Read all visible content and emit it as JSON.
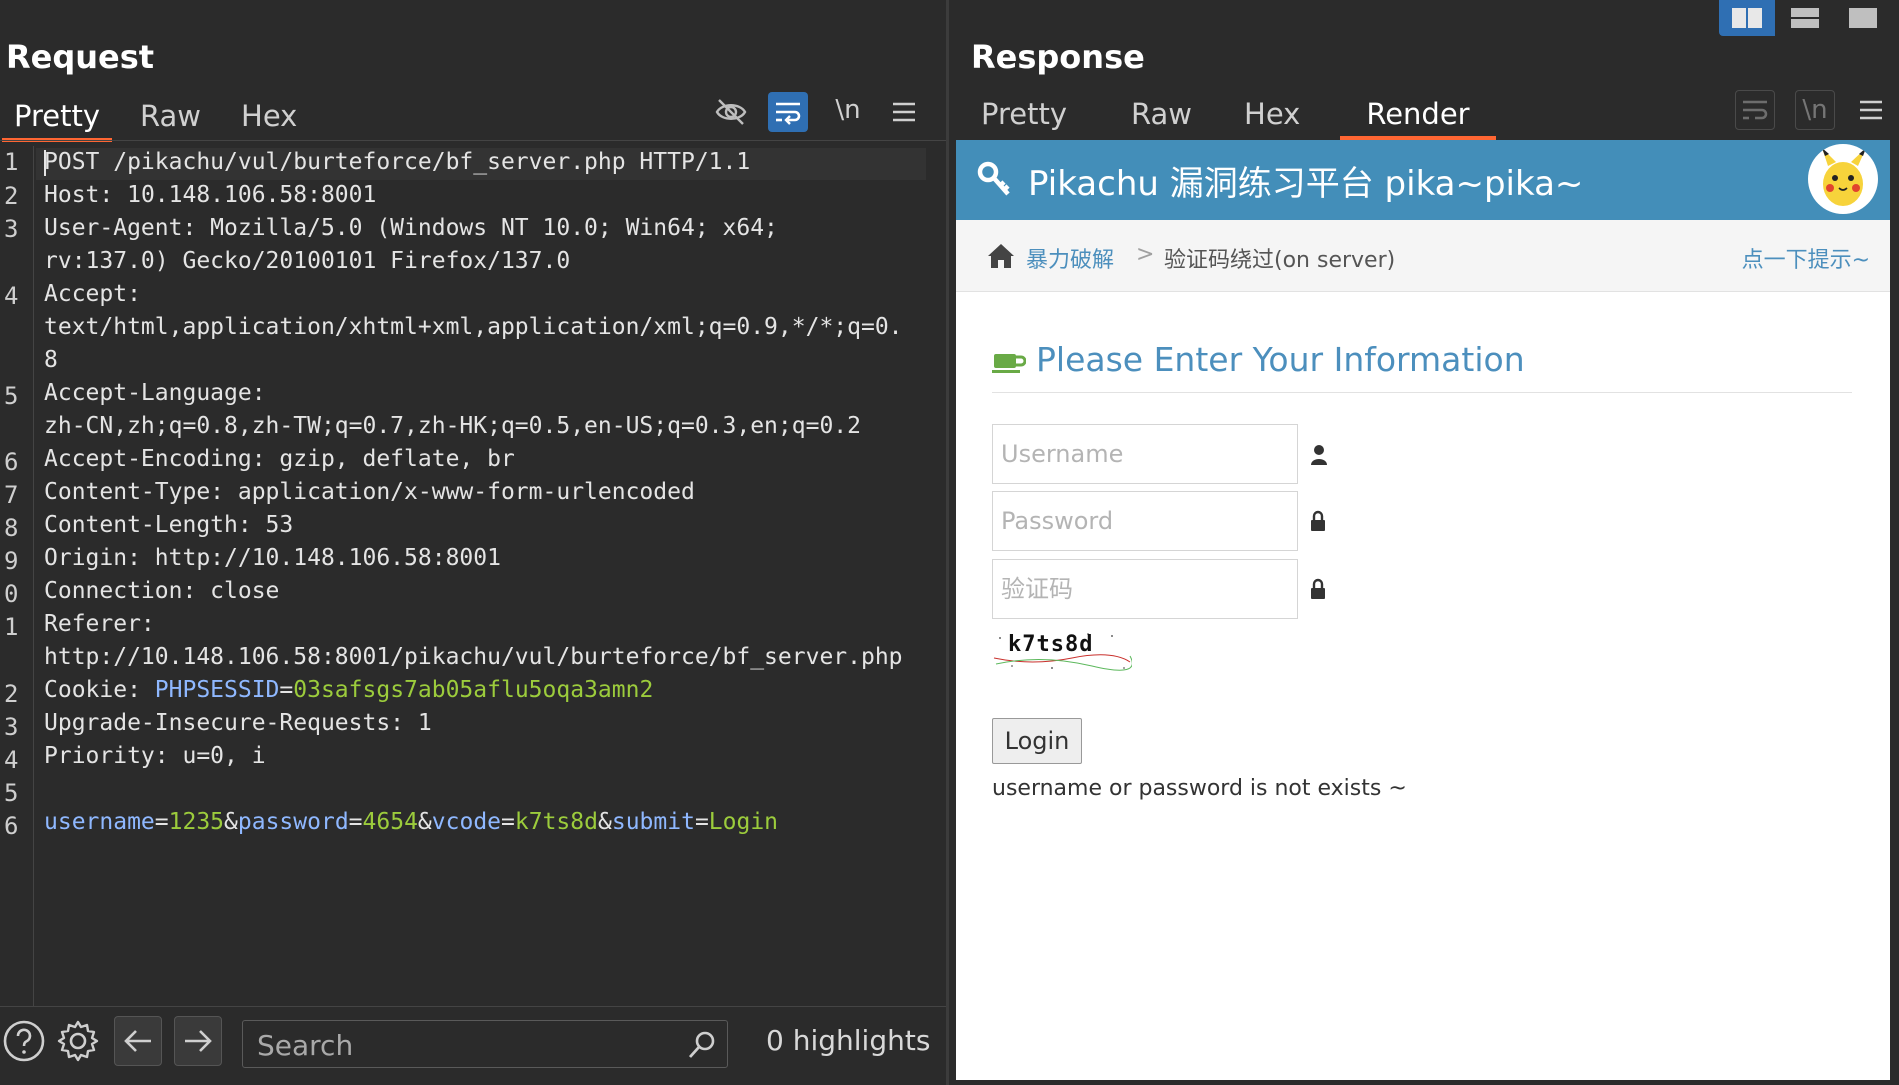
{
  "request": {
    "title": "Request",
    "tabs": [
      {
        "label": "Pretty",
        "active": true
      },
      {
        "label": "Raw",
        "active": false
      },
      {
        "label": "Hex",
        "active": false
      }
    ],
    "toolbar": {
      "newline_label": "\\n",
      "icons": [
        "eye-off-icon",
        "wrap-icon",
        "newline-icon",
        "menu-icon"
      ]
    },
    "line_numbers": [
      "1",
      "2",
      "3",
      "",
      "4",
      "",
      "",
      "5",
      "",
      "6",
      "7",
      "8",
      "9",
      "0",
      "1",
      "",
      "2",
      "3",
      "4",
      "5",
      "6"
    ],
    "lines": {
      "l1": "POST /pikachu/vul/burteforce/bf_server.php HTTP/1.1",
      "l2_key": "Host: ",
      "l2_val": "10.148.106.58:8001",
      "l3a": "User-Agent: Mozilla/5.0 (Windows NT 10.0; Win64; x64;",
      "l3b": "rv:137.0) Gecko/20100101 Firefox/137.0",
      "l4a": "Accept:",
      "l4b": "text/html,application/xhtml+xml,application/xml;q=0.9,*/*;q=0.",
      "l4c": "8",
      "l5a": "Accept-Language:",
      "l5b": "zh-CN,zh;q=0.8,zh-TW;q=0.7,zh-HK;q=0.5,en-US;q=0.3,en;q=0.2",
      "l6": "Accept-Encoding: gzip, deflate, br",
      "l7": "Content-Type: application/x-www-form-urlencoded",
      "l8": "Content-Length: 53",
      "l9": "Origin: http://10.148.106.58:8001",
      "l10": "Connection: close",
      "l11a": "Referer:",
      "l11b": "http://10.148.106.58:8001/pikachu/vul/burteforce/bf_server.php",
      "l12_key": "Cookie: ",
      "l12_name": "PHPSESSID",
      "l12_eq": "=",
      "l12_val": "03safsgs7ab05aflu5oqa3amn2",
      "l13": "Upgrade-Insecure-Requests: 1",
      "l14": "Priority: u=0, i",
      "body": {
        "k1": "username",
        "e1": "=",
        "v1": "1235",
        "a1": "&",
        "k2": "password",
        "e2": "=",
        "v2": "4654",
        "a2": "&",
        "k3": "vcode",
        "e3": "=",
        "v3": "k7ts8d",
        "a3": "&",
        "k4": "submit",
        "e4": "=",
        "v4": "Login"
      }
    },
    "search": {
      "placeholder": "Search",
      "value": ""
    },
    "highlights": "0 highlights"
  },
  "response": {
    "title": "Response",
    "tabs": [
      {
        "label": "Pretty",
        "active": false
      },
      {
        "label": "Raw",
        "active": false
      },
      {
        "label": "Hex",
        "active": false
      },
      {
        "label": "Render",
        "active": true
      }
    ],
    "newline_label": "\\n",
    "layout_buttons": [
      "split-horizontal-icon",
      "split-vertical-icon",
      "single-pane-icon"
    ],
    "render": {
      "site_title": "Pikachu 漏洞练习平台 pika~pika~",
      "breadcrumb": {
        "link": "暴力破解",
        "sep": ">",
        "current": "验证码绕过(on server)",
        "hint": "点一下提示~"
      },
      "heading": "Please Enter Your Information",
      "username_placeholder": "Username",
      "password_placeholder": "Password",
      "vcode_placeholder": "验证码",
      "captcha_text": "k7ts8d",
      "login_label": "Login",
      "message": "username or password is not exists ~"
    }
  },
  "colors": {
    "accent_orange": "#ff6633",
    "active_blue": "#2f6fb3",
    "pikachu_blue": "#438eb9",
    "value_green": "#9ccc3c",
    "key_blue": "#8fb8ff"
  }
}
